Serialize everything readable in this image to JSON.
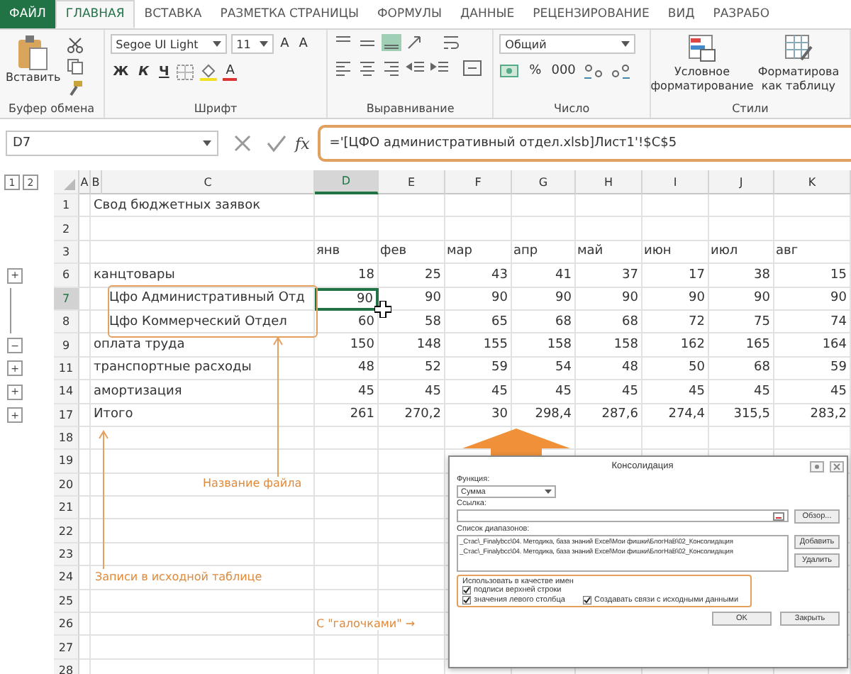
{
  "tabs": [
    {
      "label": "ФАЙЛ",
      "kind": "file",
      "selected": false
    },
    {
      "label": "ГЛАВНАЯ",
      "kind": "tab",
      "selected": true
    },
    {
      "label": "ВСТАВКА",
      "kind": "tab",
      "selected": false
    },
    {
      "label": "РАЗМЕТКА СТРАНИЦЫ",
      "kind": "tab",
      "selected": false
    },
    {
      "label": "ФОРМУЛЫ",
      "kind": "tab",
      "selected": false
    },
    {
      "label": "ДАННЫЕ",
      "kind": "tab",
      "selected": false
    },
    {
      "label": "РЕЦЕНЗИРОВАНИЕ",
      "kind": "tab",
      "selected": false
    },
    {
      "label": "ВИД",
      "kind": "tab",
      "selected": false
    },
    {
      "label": "РАЗРАБО",
      "kind": "tab",
      "selected": false
    }
  ],
  "ribbon": {
    "clipboard": {
      "label": "Буфер обмена",
      "paste": "Вставить"
    },
    "font": {
      "label": "Шрифт",
      "font_name": "Segoe UI Light",
      "font_size": "11",
      "size_buttons": [
        "A",
        "A"
      ],
      "style_buttons": [
        "Ж",
        "К",
        "Ч"
      ],
      "color_button": "A"
    },
    "alignment": {
      "label": "Выравнивание"
    },
    "number": {
      "label": "Число",
      "format": "Общий",
      "buttons": [
        "%",
        "000"
      ]
    },
    "styles": {
      "label": "Стили",
      "buttons": [
        "Условное\nформатирование",
        "Форматирова\nкак таблицу"
      ]
    }
  },
  "formula_bar": {
    "name_box": "D7",
    "fx": "fx",
    "formula": "='[ЦФО административный отдел.xlsb]Лист1'!$C$5"
  },
  "sheet": {
    "outline_levels": [
      "1",
      "2"
    ],
    "columns": [
      {
        "label": "A",
        "selected": false
      },
      {
        "label": "B",
        "selected": false
      },
      {
        "label": "C",
        "selected": false
      },
      {
        "label": "D",
        "selected": true
      },
      {
        "label": "E",
        "selected": false
      },
      {
        "label": "F",
        "selected": false
      },
      {
        "label": "G",
        "selected": false
      },
      {
        "label": "H",
        "selected": false
      },
      {
        "label": "I",
        "selected": false
      },
      {
        "label": "J",
        "selected": false
      },
      {
        "label": "K",
        "selected": false
      }
    ],
    "rows": [
      {
        "number": "1",
        "selected": false,
        "label": "Свод бюджетных заявок"
      },
      {
        "number": "2",
        "selected": false
      },
      {
        "number": "3",
        "selected": false,
        "kind": "header",
        "values": [
          "янв",
          "фев",
          "мар",
          "апр",
          "май",
          "июн",
          "июл",
          "авг"
        ]
      },
      {
        "number": "6",
        "selected": false,
        "outline": "+",
        "label": "канцтовары",
        "values": [
          "18",
          "25",
          "43",
          "41",
          "37",
          "17",
          "38",
          "15"
        ]
      },
      {
        "number": "7",
        "selected": true,
        "outline_member": true,
        "indented": true,
        "label": "Цфо Административный Отд",
        "values": [
          "90",
          "90",
          "90",
          "90",
          "90",
          "90",
          "90",
          "90"
        ]
      },
      {
        "number": "8",
        "selected": false,
        "outline_member": true,
        "indented": true,
        "label": "Цфо Коммерческий Отдел",
        "values": [
          "60",
          "58",
          "65",
          "68",
          "68",
          "72",
          "75",
          "74"
        ]
      },
      {
        "number": "9",
        "selected": false,
        "outline": "−",
        "label": "оплата труда",
        "values": [
          "150",
          "148",
          "155",
          "158",
          "158",
          "162",
          "165",
          "164"
        ]
      },
      {
        "number": "11",
        "selected": false,
        "outline": "+",
        "label": "транспортные расходы",
        "values": [
          "48",
          "52",
          "59",
          "54",
          "48",
          "50",
          "68",
          "59"
        ]
      },
      {
        "number": "14",
        "selected": false,
        "outline": "+",
        "label": "амортизация",
        "values": [
          "45",
          "45",
          "45",
          "45",
          "45",
          "45",
          "45",
          "45"
        ]
      },
      {
        "number": "17",
        "selected": false,
        "outline": "+",
        "label": "Итого",
        "values": [
          "261",
          "270,2",
          "30",
          "298,4",
          "287,6",
          "274,4",
          "315,5",
          "283,2"
        ]
      },
      {
        "number": "18",
        "selected": false
      },
      {
        "number": "19",
        "selected": false
      },
      {
        "number": "20",
        "selected": false
      },
      {
        "number": "21",
        "selected": false
      },
      {
        "number": "22",
        "selected": false
      },
      {
        "number": "23",
        "selected": false
      },
      {
        "number": "24",
        "selected": false
      },
      {
        "number": "25",
        "selected": false
      },
      {
        "number": "26",
        "selected": false
      },
      {
        "number": "27",
        "selected": false
      },
      {
        "number": "28",
        "selected": false
      }
    ]
  },
  "annotations": [
    {
      "kind": "file_name",
      "text": "Название файла"
    },
    {
      "kind": "source_records",
      "text": "Записи в исходной таблице"
    },
    {
      "kind": "checkmarks",
      "text": "С \"галочками\" →"
    }
  ],
  "dialog": {
    "title": "Консолидация",
    "function_label": "Функция:",
    "function": "Сумма",
    "reference_label": "Ссылка:",
    "browse": "Обзор...",
    "ranges_label": "Список диапазонов:",
    "ranges": [
      "_Стас\\_Finalybcc\\04. Методика, база знаний Excel\\Мои фишки\\БлогНаВ\\02_Консолидация",
      "_Стас\\_Finalybcc\\04. Методика, база знаний Excel\\Мои фишки\\БлогНаВ\\02_Консолидация"
    ],
    "add": "Добавить",
    "delete": "Удалить",
    "names_label": "Использовать в качестве имен",
    "options": [
      {
        "label": "подписи верхней строки",
        "checked": true
      },
      {
        "label": "значения левого столбца",
        "checked": true
      },
      {
        "label": "Создавать связи с исходными данными",
        "checked": true
      }
    ],
    "ok": "OK",
    "close": "Закрыть"
  }
}
